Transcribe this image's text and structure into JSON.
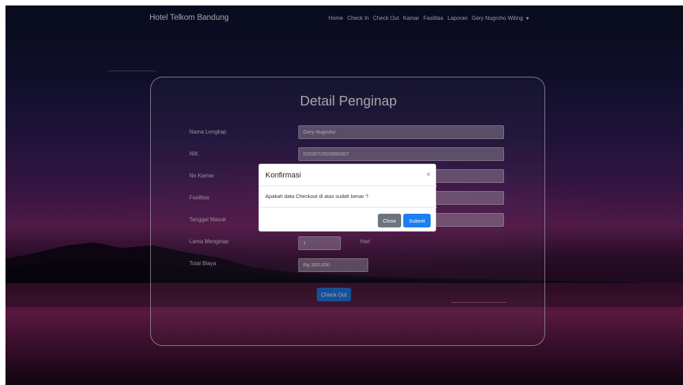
{
  "navbar": {
    "brand": "Hotel Telkom Bandung",
    "items": [
      "Home",
      "Check In",
      "Check Out",
      "Kamar",
      "Fasilitas",
      "Laporan",
      "Gery Nugroho Witing"
    ]
  },
  "form": {
    "title": "Detail Penginap",
    "fields": [
      {
        "label": "Nama Lengkap",
        "value": "Gery Nugroho"
      },
      {
        "label": "NIK",
        "value": "5203072503990007"
      },
      {
        "label": "No Kamar",
        "value": ""
      },
      {
        "label": "Fasilitas",
        "value": ""
      },
      {
        "label": "Tanggal Masuk",
        "value": ""
      },
      {
        "label": "Lama Menginap",
        "value": "1",
        "suffix": "Hari"
      },
      {
        "label": "Total Biaya",
        "value": "Rp.300,000"
      }
    ],
    "submit_label": "Check Out"
  },
  "modal": {
    "title": "Konfirmasi",
    "close_symbol": "×",
    "message": "Apakah data Checkout di atas sudah benar ?",
    "close_label": "Close",
    "submit_label": "Submit"
  }
}
